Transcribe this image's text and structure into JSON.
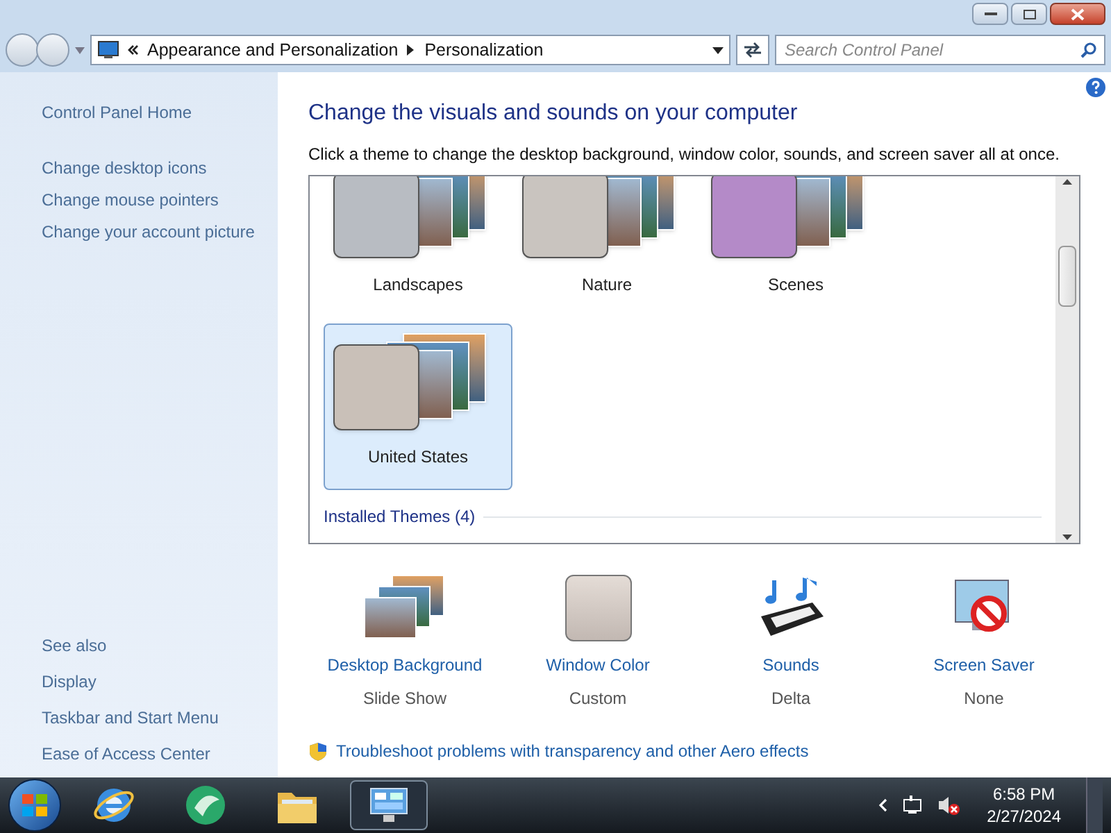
{
  "address_bar": {
    "crumbs": [
      "Appearance and Personalization",
      "Personalization"
    ]
  },
  "search": {
    "placeholder": "Search Control Panel"
  },
  "sidebar": {
    "links": [
      "Control Panel Home",
      "Change desktop icons",
      "Change mouse pointers",
      "Change your account picture"
    ],
    "see_also": {
      "heading": "See also",
      "links": [
        "Display",
        "Taskbar and Start Menu",
        "Ease of Access Center"
      ]
    }
  },
  "main": {
    "title": "Change the visuals and sounds on your computer",
    "subtitle": "Click a theme to change the desktop background, window color, sounds, and screen saver all at once.",
    "themes": [
      {
        "name": "Landscapes",
        "selected": false,
        "color": "#b8bcc2"
      },
      {
        "name": "Nature",
        "selected": false,
        "color": "#c9c4bf"
      },
      {
        "name": "Scenes",
        "selected": false,
        "color": "#b48ac8"
      },
      {
        "name": "United States",
        "selected": true,
        "color": "#c9c0b8"
      }
    ],
    "installed_heading": "Installed Themes (4)",
    "settings": [
      {
        "kind": "background",
        "label": "Desktop Background",
        "value": "Slide Show"
      },
      {
        "kind": "color",
        "label": "Window Color",
        "value": "Custom"
      },
      {
        "kind": "sounds",
        "label": "Sounds",
        "value": "Delta"
      },
      {
        "kind": "saver",
        "label": "Screen Saver",
        "value": "None"
      }
    ],
    "troubleshoot_link": "Troubleshoot problems with transparency and other Aero effects"
  },
  "taskbar": {
    "apps": [
      {
        "kind": "ie",
        "active": false
      },
      {
        "kind": "media",
        "active": false
      },
      {
        "kind": "explorer",
        "active": false
      },
      {
        "kind": "control",
        "active": true
      }
    ],
    "time": "6:58 PM",
    "date": "2/27/2024"
  }
}
